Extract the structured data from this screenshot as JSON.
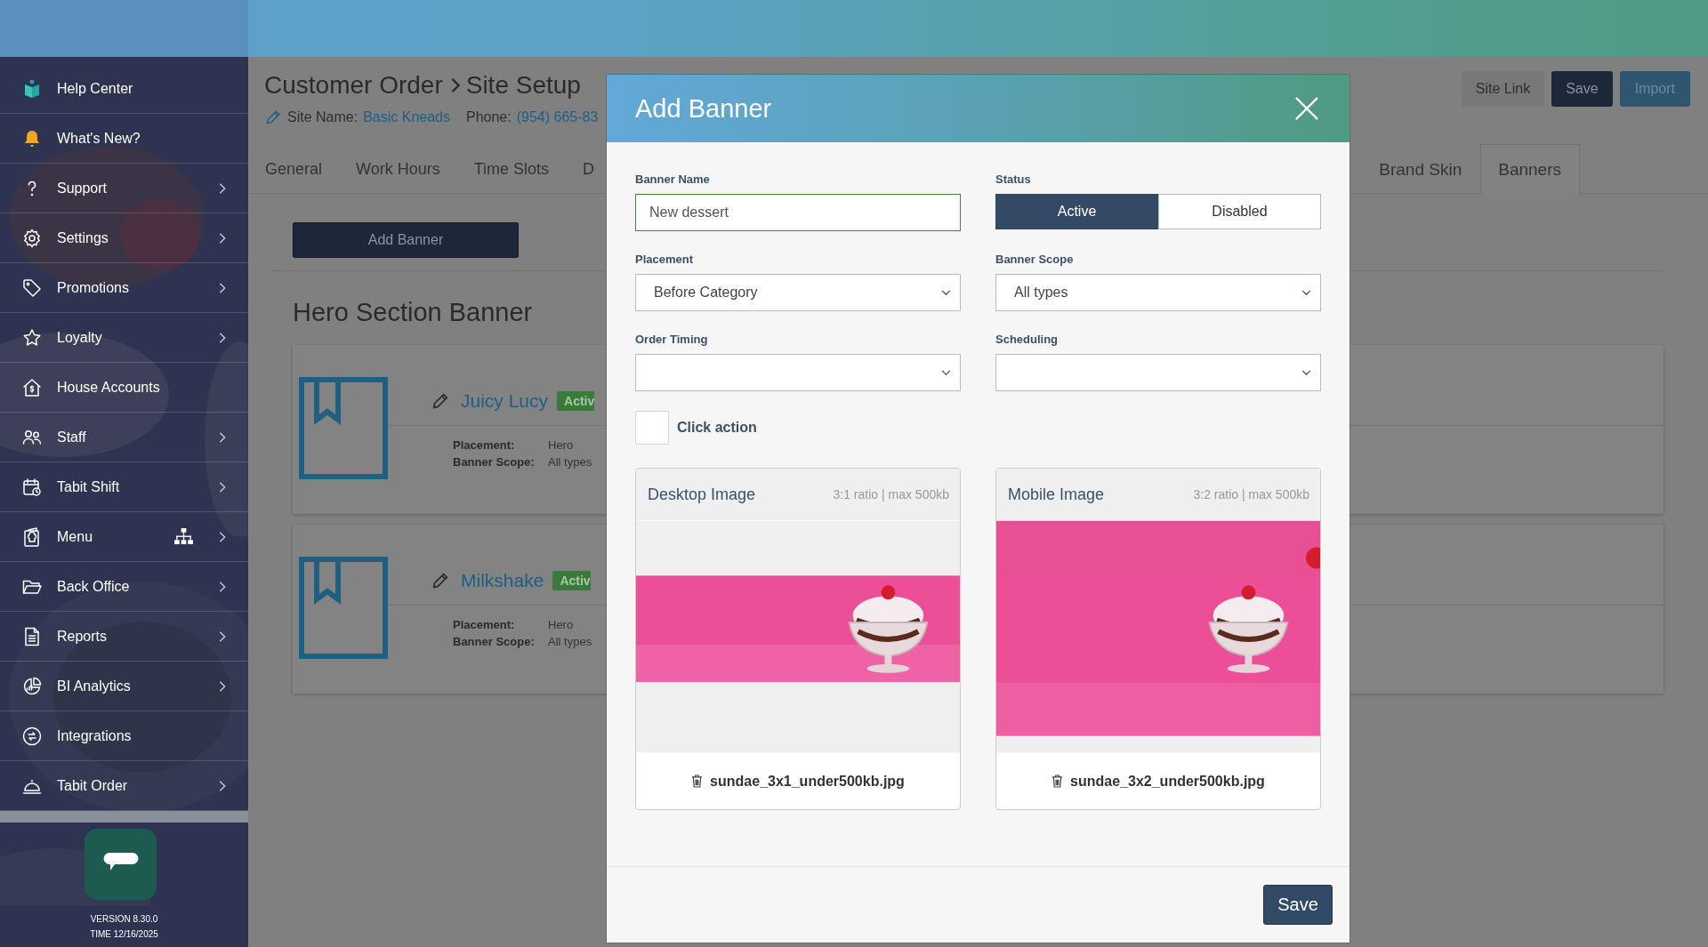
{
  "sidebar": {
    "items": [
      {
        "label": "Help Center",
        "expandable": false
      },
      {
        "label": "What's New?",
        "expandable": false
      },
      {
        "label": "Support",
        "expandable": true
      },
      {
        "label": "Settings",
        "expandable": true
      },
      {
        "label": "Promotions",
        "expandable": true
      },
      {
        "label": "Loyalty",
        "expandable": true
      },
      {
        "label": "House Accounts",
        "expandable": false
      },
      {
        "label": "Staff",
        "expandable": true
      },
      {
        "label": "Tabit Shift",
        "expandable": true
      },
      {
        "label": "Menu",
        "expandable": true
      },
      {
        "label": "Back Office",
        "expandable": true
      },
      {
        "label": "Reports",
        "expandable": true
      },
      {
        "label": "BI Analytics",
        "expandable": true
      },
      {
        "label": "Integrations",
        "expandable": false
      },
      {
        "label": "Tabit Order",
        "expandable": true
      }
    ],
    "version": "VERSION 8.30.0",
    "time": "TIME 12/16/2025"
  },
  "page": {
    "breadcrumb": [
      "Customer Order",
      "Site Setup"
    ],
    "site_name_label": "Site Name:",
    "site_name": "Basic Kneads",
    "phone_label": "Phone:",
    "phone": "(954) 665-83",
    "header_buttons": [
      {
        "label": "Site Link",
        "kind": "secondary"
      },
      {
        "label": "Save",
        "kind": "primary"
      },
      {
        "label": "Import",
        "kind": "import"
      }
    ],
    "tabs": [
      {
        "label": "General",
        "selected": false
      },
      {
        "label": "Work Hours",
        "selected": false
      },
      {
        "label": "Time Slots",
        "selected": false
      },
      {
        "label": "D",
        "selected": false
      }
    ],
    "tabs_right": [
      {
        "label": "Brand Skin",
        "selected": false
      },
      {
        "label": "Banners",
        "selected": true
      }
    ],
    "add_button": "Add Banner",
    "section_title": "Hero Section Banner",
    "banners": [
      {
        "name": "Juicy Lucy",
        "status": "Activ",
        "placement_label": "Placement:",
        "placement": "Hero",
        "scope_label": "Banner Scope:",
        "scope": "All types"
      },
      {
        "name": "Milkshake",
        "status": "Activ",
        "placement_label": "Placement:",
        "placement": "Hero",
        "scope_label": "Banner Scope:",
        "scope": "All types"
      }
    ]
  },
  "modal": {
    "title": "Add Banner",
    "banner_name": {
      "label": "Banner Name",
      "value": "New dessert"
    },
    "status": {
      "label": "Status",
      "options": [
        {
          "label": "Active",
          "selected": true
        },
        {
          "label": "Disabled",
          "selected": false
        }
      ]
    },
    "placement": {
      "label": "Placement",
      "value": "Before Category"
    },
    "banner_scope": {
      "label": "Banner Scope",
      "value": "All types"
    },
    "order_timing": {
      "label": "Order Timing"
    },
    "scheduling": {
      "label": "Scheduling"
    },
    "click_action": {
      "label": "Click action",
      "checked": false
    },
    "images": [
      {
        "title": "Desktop Image",
        "hint": "3:1 ratio | max 500kb",
        "filename": "sundae_3x1_under500kb.jpg",
        "kind": "desktop"
      },
      {
        "title": "Mobile Image",
        "hint": "3:2 ratio | max 500kb",
        "filename": "sundae_3x2_under500kb.jpg",
        "kind": "mobile"
      }
    ],
    "save": "Save"
  }
}
